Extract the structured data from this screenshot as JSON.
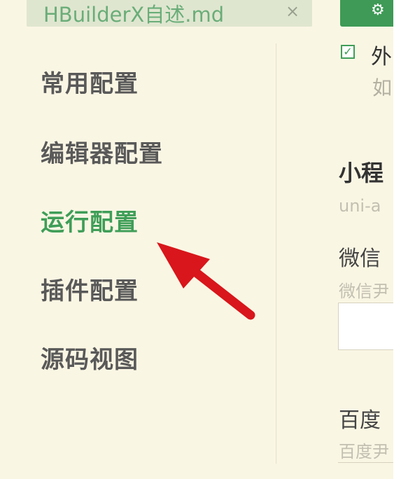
{
  "tab": {
    "title": "HBuilderX自述.md",
    "close": "×"
  },
  "settings_button": {
    "icon": "gear-icon"
  },
  "sidebar": {
    "items": [
      {
        "label": "常用配置",
        "active": false
      },
      {
        "label": "编辑器配置",
        "active": false
      },
      {
        "label": "运行配置",
        "active": true
      },
      {
        "label": "插件配置",
        "active": false
      },
      {
        "label": "源码视图",
        "active": false
      }
    ]
  },
  "panel": {
    "checkbox_label": "外",
    "checkbox_hint": "如",
    "checked": true,
    "section_title": "小程",
    "section_sub": "uni-a",
    "wechat_label": "微信",
    "wechat_hint": "微信尹",
    "baidu_label": "百度",
    "baidu_hint": "百度尹"
  },
  "colors": {
    "accent": "#3f9e58",
    "background": "#faf6e4",
    "annotation_arrow": "#d8161b"
  }
}
